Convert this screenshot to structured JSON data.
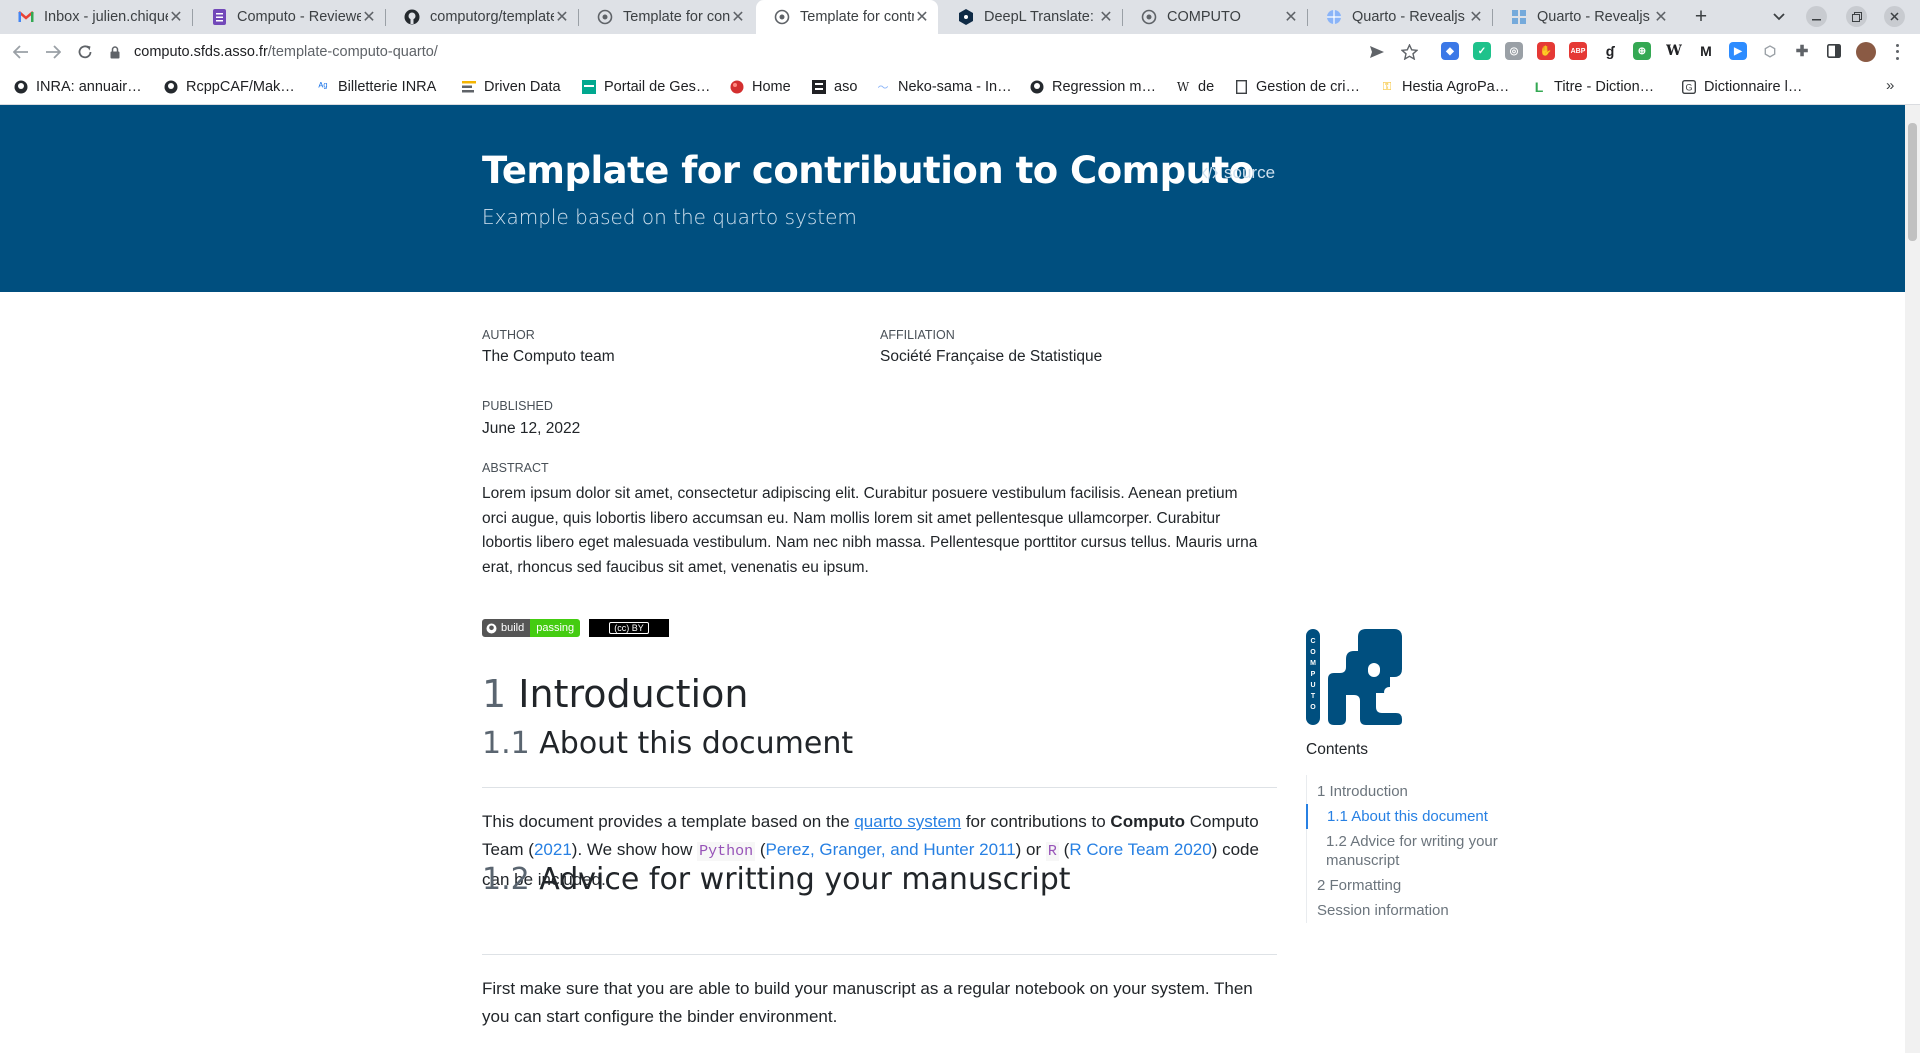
{
  "browser": {
    "tabs": [
      {
        "title": "Inbox - julien.chiquet",
        "icon": "gmail-icon",
        "active": false
      },
      {
        "title": "Computo - Reviewers",
        "icon": "sheet-icon",
        "active": false
      },
      {
        "title": "computorg/template",
        "icon": "github-icon",
        "active": false
      },
      {
        "title": "Template for contribution",
        "icon": "globe-icon",
        "active": false
      },
      {
        "title": "Template for contribution",
        "icon": "globe-icon",
        "active": true
      },
      {
        "title": "DeepL Translate:",
        "icon": "deepl-icon",
        "active": false
      },
      {
        "title": "COMPUTO",
        "icon": "globe-icon",
        "active": false
      },
      {
        "title": "Quarto - Revealjs",
        "icon": "world-icon",
        "active": false
      },
      {
        "title": "Quarto - Revealjs",
        "icon": "quarto-icon",
        "active": false
      }
    ],
    "new_tab": "+",
    "url_host": "computo.sfds.asso.fr",
    "url_path": "/template-computo-quarto/",
    "bookmarks": [
      {
        "label": "INRA: annuair…",
        "icon": "github-icon"
      },
      {
        "label": "RcppCAF/Mak…",
        "icon": "github-icon"
      },
      {
        "label": "Billetterie INRA",
        "icon": "ticket-icon"
      },
      {
        "label": "Driven Data",
        "icon": "lines-icon"
      },
      {
        "label": "Portail de Ges…",
        "icon": "portal-icon"
      },
      {
        "label": "Home",
        "icon": "home-icon"
      },
      {
        "label": "aso",
        "icon": "aso-icon"
      },
      {
        "label": "Neko-sama - In…",
        "icon": "neko-icon"
      },
      {
        "label": "Regression m…",
        "icon": "github-icon"
      },
      {
        "label": "de",
        "icon": "wiki-icon"
      },
      {
        "label": "Gestion de cri…",
        "icon": "doc-icon"
      },
      {
        "label": "Hestia AgroPa…",
        "icon": "key-icon"
      },
      {
        "label": "Titre - Diction…",
        "icon": "l-icon"
      },
      {
        "label": "Dictionnaire l…",
        "icon": "dict-icon"
      }
    ],
    "bookmarks_more": "»"
  },
  "page": {
    "title": "Template for contribution to Computo",
    "subtitle": "Example based on the quarto system",
    "source_label": "source",
    "author_label": "AUTHOR",
    "author": "The Computo team",
    "affiliation_label": "AFFILIATION",
    "affiliation": "Société Française de Statistique",
    "published_label": "PUBLISHED",
    "published": "June 12, 2022",
    "abstract_label": "ABSTRACT",
    "abstract": "Lorem ipsum dolor sit amet, consectetur adipiscing elit. Curabitur posuere vestibulum facilisis. Aenean pretium orci augue, quis lobortis libero accumsan eu. Nam mollis lorem sit amet pellentesque ullamcorper. Curabitur lobortis libero eget malesuada vestibulum. Nam nec nibh massa. Pellentesque porttitor cursus tellus. Mauris urna erat, rhoncus sed faucibus sit amet, venenatis eu ipsum.",
    "badge_build_left": "build",
    "badge_build_right": "passing",
    "badge_cc": "(cc) BY",
    "sec1_num": "1",
    "sec1_title": "Introduction",
    "sec11_num": "1.1",
    "sec11_title": "About this document",
    "para1": {
      "t1": "This document provides a template based on the ",
      "link_quarto": "quarto system",
      "t2": " for contributions to ",
      "bold": "Computo",
      "t3": " Computo Team (",
      "cite_year": "2021",
      "t4": "). We show how ",
      "code_python": "Python",
      "t5": " (",
      "cite_python": "Perez, Granger, and Hunter 2011",
      "t6": ") or ",
      "code_r": "R",
      "t7": " (",
      "cite_r": "R Core Team 2020",
      "t8": ") code can be included."
    },
    "sec12_num": "1.2",
    "sec12_title": "Advice for writting your manuscript",
    "para2": "First make sure that you are able to build your manuscript as a regular notebook on your system. Then you can start configure the binder environment."
  },
  "sidebar": {
    "logo_text": "COMPUTO",
    "contents_title": "Contents",
    "toc": [
      {
        "label": "1 Introduction",
        "level": 1,
        "active": false
      },
      {
        "label": "1.1 About this document",
        "level": 2,
        "active": true
      },
      {
        "label": "1.2 Advice for writing your manuscript",
        "level": 2,
        "active": false
      },
      {
        "label": "2 Formatting",
        "level": 1,
        "active": false
      },
      {
        "label": "Session information",
        "level": 1,
        "active": false
      }
    ]
  },
  "colors": {
    "banner": "#004f7f",
    "link": "#2780e3",
    "code": "#9753b8"
  }
}
